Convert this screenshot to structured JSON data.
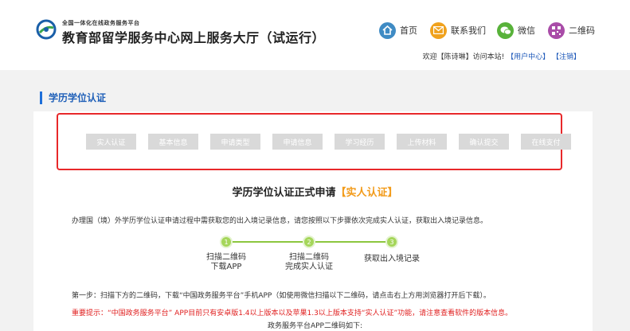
{
  "header": {
    "platform_name": "全国一体化在线政务服务平台",
    "site_title": "教育部留学服务中心网上服务大厅（试运行）",
    "nav": [
      {
        "label": "首页",
        "icon": "home-icon",
        "color": "#3f8bc4"
      },
      {
        "label": "联系我们",
        "icon": "mail-icon",
        "color": "#f0a21e"
      },
      {
        "label": "微信",
        "icon": "wechat-icon",
        "color": "#58b23a"
      },
      {
        "label": "二维码",
        "icon": "qrcode-icon",
        "color": "#a94ca8"
      }
    ],
    "user_bar": {
      "welcome": "欢迎【陈诗琳】访问本站!",
      "user_center": "【用户中心】",
      "logout": "【注销】"
    }
  },
  "section_title": "学历学位认证",
  "steps": [
    "实人认证",
    "基本信息",
    "申请类型",
    "申请信息",
    "学习经历",
    "上传材料",
    "确认提交",
    "在线支付"
  ],
  "main": {
    "title": "学历学位认证正式申请",
    "title_highlight": "【实人认证】",
    "intro": "办理国（境）外学历学位认证申请过程中需获取您的出入境记录信息，请您按照以下步骤依次完成实人认证，获取出入境记录信息。",
    "progress": [
      {
        "num": "1",
        "label_lines": [
          "扫描二维码",
          "下载APP"
        ]
      },
      {
        "num": "2",
        "label_lines": [
          "扫描二维码",
          "完成实人认证"
        ]
      },
      {
        "num": "3",
        "label_lines": [
          "获取出入境记录"
        ]
      }
    ],
    "step1_text": "第一步：扫描下方的二维码，下载“中国政务服务平台”手机APP（如使用微信扫描以下二维码，请点击右上方用浏览器打开后下载）。",
    "notice": "重要提示：“中国政务服务平台” APP目前只有安卓版1.4以上版本以及苹果1.3以上版本支持“实人认证”功能，请注意查看软件的版本信息。",
    "qr_caption": "政务服务平台APP二维码如下:"
  },
  "colors": {
    "accent_blue": "#1e6fd9",
    "highlight_orange": "#f29b1a",
    "notice_red": "#e02020",
    "step_box_red": "#e8282a",
    "progress_green": "#8cc63f"
  }
}
